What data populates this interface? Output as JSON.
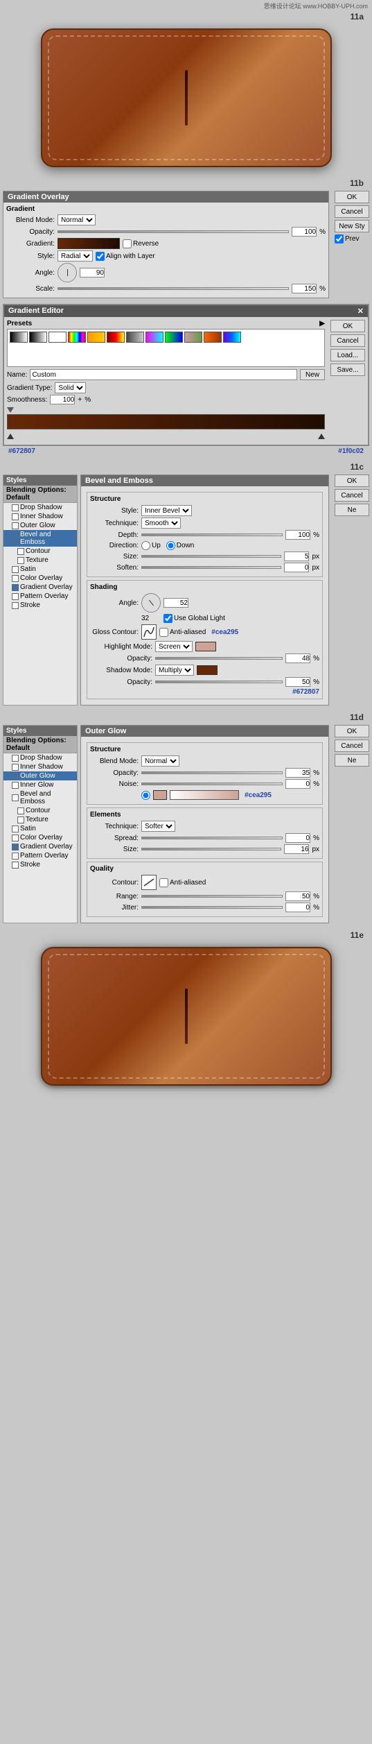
{
  "site_label": "思维设计论坛 www.HOBBY-UPH.com",
  "sections": {
    "11a": "11a",
    "11b": "11b",
    "11c": "11c",
    "11d": "11d",
    "11e": "11e"
  },
  "gradient_overlay_dialog": {
    "title": "Gradient Overlay",
    "ok_label": "OK",
    "cancel_label": "Cancel",
    "new_style_label": "New Sty",
    "preview_label": "Prev",
    "fields": {
      "blend_mode": {
        "label": "Blend Mode:",
        "value": "Normal"
      },
      "opacity": {
        "label": "Opacity:",
        "value": "100",
        "unit": "%"
      },
      "gradient_label": "Gradient:",
      "reverse_label": "Reverse",
      "style": {
        "label": "Style:",
        "value": "Radial"
      },
      "align_with_layer_label": "Align with Layer",
      "angle": {
        "label": "Angle:",
        "value": "90"
      },
      "scale": {
        "label": "Scale:",
        "value": "150",
        "unit": "%"
      }
    }
  },
  "gradient_editor": {
    "title": "Gradient Editor",
    "ok_label": "OK",
    "cancel_label": "Cancel",
    "load_label": "Load...",
    "save_label": "Save...",
    "presets_label": "Presets",
    "name_label": "Name:",
    "name_value": "Custom",
    "new_label": "New",
    "gradient_type_label": "Gradient Type:",
    "gradient_type_value": "Solid",
    "smoothness_label": "Smoothness:",
    "smoothness_value": "100",
    "smoothness_unit": "%",
    "color_left": "#672807",
    "color_right": "#1f0c02"
  },
  "bevel_emboss_dialog": {
    "title": "Bevel and Emboss",
    "ok_label": "OK",
    "cancel_label": "Cancel",
    "new_label": "Ne",
    "sections": {
      "structure": "Structure",
      "shading": "Shading"
    },
    "fields": {
      "style": {
        "label": "Style:",
        "value": "Inner Bevel"
      },
      "technique": {
        "label": "Technique:",
        "value": "Smooth"
      },
      "depth": {
        "label": "Depth:",
        "value": "100",
        "unit": "%"
      },
      "direction_label": "Direction:",
      "direction_up": "Up",
      "direction_down": "Down",
      "size": {
        "label": "Size:",
        "value": "5",
        "unit": "px"
      },
      "soften": {
        "label": "Soften:",
        "value": "0",
        "unit": "px"
      },
      "angle": {
        "label": "Angle:",
        "value": "52"
      },
      "altitude": {
        "value": "32"
      },
      "use_global_light": "Use Global Light",
      "gloss_contour": "Gloss Contour:",
      "anti_aliased": "Anti-aliased",
      "highlight_mode": {
        "label": "Highlight Mode:",
        "value": "Screen"
      },
      "highlight_opacity": {
        "label": "Opacity:",
        "value": "48",
        "unit": "%"
      },
      "shadow_mode": {
        "label": "Shadow Mode:",
        "value": "Multiply"
      },
      "shadow_opacity": {
        "label": "Opacity:",
        "value": "50",
        "unit": "%"
      }
    },
    "color_highlight": "#cea295",
    "color_shadow": "#672807"
  },
  "styles_panel_bevel": {
    "title": "Styles",
    "blending_options": "Blending Options: Default",
    "items": [
      {
        "label": "Drop Shadow",
        "checked": false,
        "active": false
      },
      {
        "label": "Inner Shadow",
        "checked": false,
        "active": false
      },
      {
        "label": "Outer Glow",
        "checked": false,
        "active": false
      },
      {
        "label": "Bevel and Emboss",
        "checked": true,
        "active": true
      },
      {
        "label": "Contour",
        "checked": false,
        "active": false,
        "indent": true
      },
      {
        "label": "Texture",
        "checked": false,
        "active": false,
        "indent": true
      },
      {
        "label": "Satin",
        "checked": false,
        "active": false
      },
      {
        "label": "Color Overlay",
        "checked": false,
        "active": false
      },
      {
        "label": "Gradient Overlay",
        "checked": true,
        "active": false
      },
      {
        "label": "Pattern Overlay",
        "checked": false,
        "active": false
      },
      {
        "label": "Stroke",
        "checked": false,
        "active": false
      }
    ]
  },
  "outer_glow_dialog": {
    "title": "Outer Glow",
    "ok_label": "OK",
    "cancel_label": "Cancel",
    "new_label": "Ne",
    "sections": {
      "structure": "Structure",
      "elements": "Elements",
      "quality": "Quality"
    },
    "fields": {
      "blend_mode": {
        "label": "Blend Mode:",
        "value": "Normal"
      },
      "opacity": {
        "label": "Opacity:",
        "value": "35",
        "unit": "%"
      },
      "noise": {
        "label": "Noise:",
        "value": "0",
        "unit": "%"
      },
      "technique": {
        "label": "Technique:",
        "value": "Softer"
      },
      "spread": {
        "label": "Spread:",
        "value": "0",
        "unit": "%"
      },
      "size": {
        "label": "Size:",
        "value": "16",
        "unit": "px"
      },
      "range": {
        "label": "Range:",
        "value": "50",
        "unit": "%"
      },
      "jitter": {
        "label": "Jitter:",
        "value": "0",
        "unit": "%"
      },
      "anti_aliased": "Anti-aliased",
      "contour_label": "Contour:"
    },
    "glow_color": "#cea295"
  },
  "styles_panel_outer_glow": {
    "title": "Styles",
    "blending_options": "Blending Options: Default",
    "items": [
      {
        "label": "Drop Shadow",
        "checked": false,
        "active": false
      },
      {
        "label": "Inner Shadow",
        "checked": false,
        "active": false
      },
      {
        "label": "Outer Glow",
        "checked": true,
        "active": true
      },
      {
        "label": "Inner Glow",
        "checked": false,
        "active": false
      },
      {
        "label": "Bevel and Emboss",
        "checked": false,
        "active": false
      },
      {
        "label": "Contour",
        "checked": false,
        "active": false,
        "indent": true
      },
      {
        "label": "Texture",
        "checked": false,
        "active": false,
        "indent": true
      },
      {
        "label": "Satin",
        "checked": false,
        "active": false
      },
      {
        "label": "Color Overlay",
        "checked": false,
        "active": false
      },
      {
        "label": "Gradient Overlay",
        "checked": true,
        "active": false
      },
      {
        "label": "Pattern Overlay",
        "checked": false,
        "active": false
      },
      {
        "label": "Stroke",
        "checked": false,
        "active": false
      }
    ]
  }
}
